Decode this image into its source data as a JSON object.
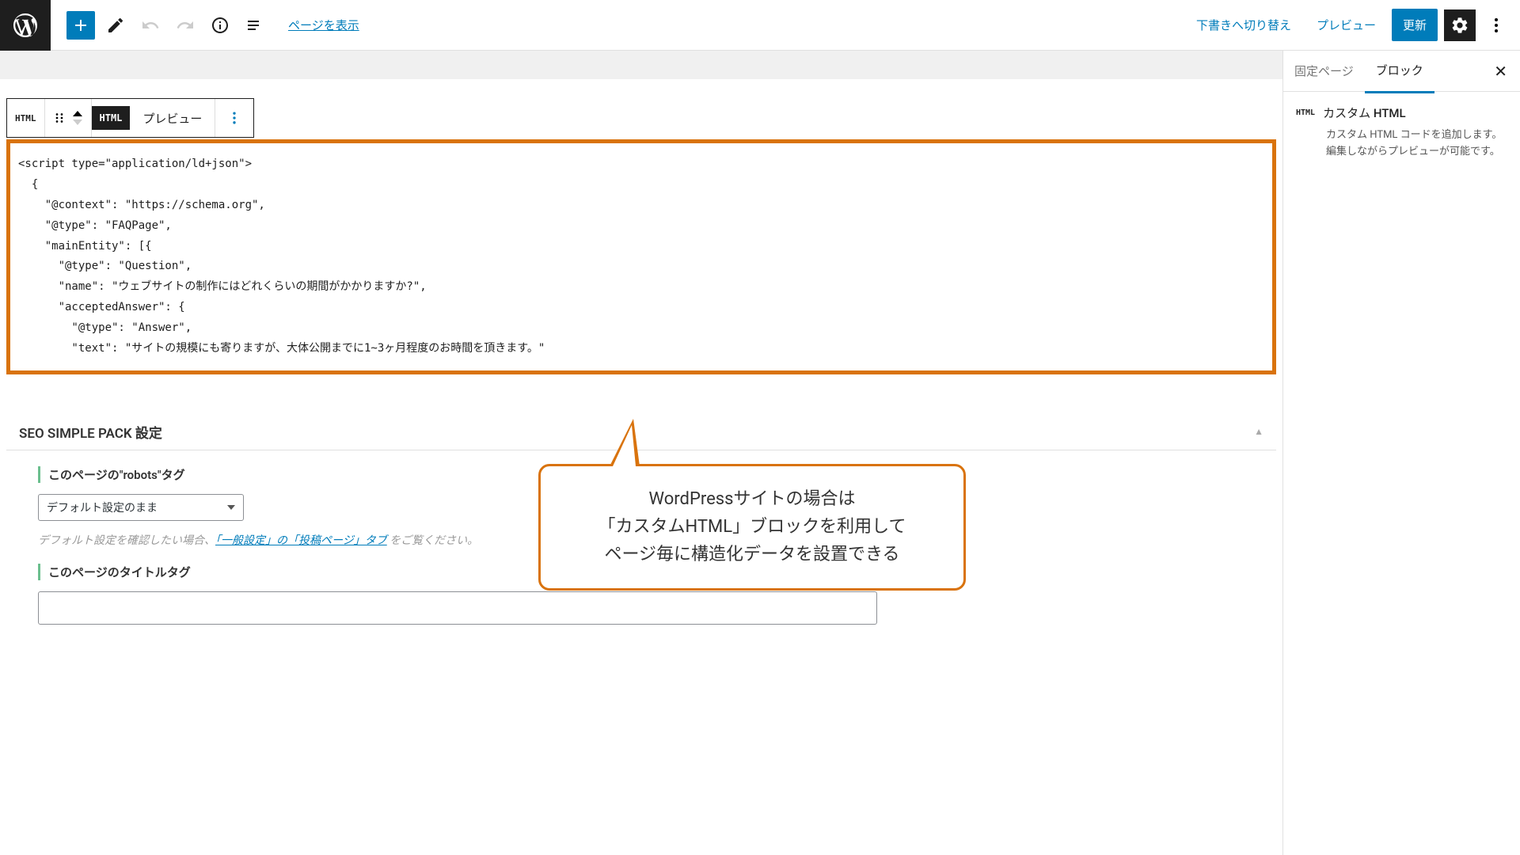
{
  "toolbar": {
    "view_page": "ページを表示",
    "switch_draft": "下書きへ切り替え",
    "preview": "プレビュー",
    "update": "更新"
  },
  "block_toolbar": {
    "html_badge": "HTML",
    "html_tab": "HTML",
    "preview_tab": "プレビュー"
  },
  "code_content": "<script type=\"application/ld+json\">\n  {\n    \"@context\": \"https://schema.org\",\n    \"@type\": \"FAQPage\",\n    \"mainEntity\": [{\n      \"@type\": \"Question\",\n      \"name\": \"ウェブサイトの制作にはどれくらいの期間がかかりますか?\",\n      \"acceptedAnswer\": {\n        \"@type\": \"Answer\",\n        \"text\": \"サイトの規模にも寄りますが、大体公開までに1~3ヶ月程度のお時間を頂きます。\"",
  "seo": {
    "section_title": "SEO SIMPLE PACK 設定",
    "robots_label": "このページの\"robots\"タグ",
    "robots_value": "デフォルト設定のまま",
    "help_prefix": "デフォルト設定を確認したい場合、",
    "help_link": "「一般設定」の「投稿ページ」タブ",
    "help_suffix": " をご覧ください。",
    "title_label": "このページのタイトルタグ"
  },
  "callout": {
    "line1": "WordPressサイトの場合は",
    "line2": "「カスタムHTML」ブロックを利用して",
    "line3": "ページ毎に構造化データを設置できる"
  },
  "sidebar": {
    "tab_page": "固定ページ",
    "tab_block": "ブロック",
    "block_badge": "HTML",
    "block_title": "カスタム HTML",
    "block_desc": "カスタム HTML コードを追加します。編集しながらプレビューが可能です。"
  }
}
